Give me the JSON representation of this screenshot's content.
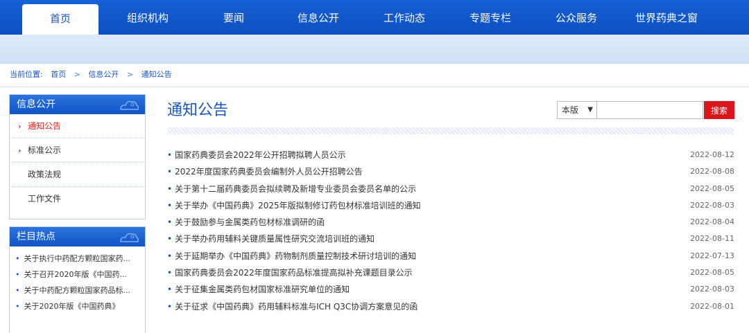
{
  "nav": {
    "items": [
      "首页",
      "组织机构",
      "要闻",
      "信息公开",
      "工作动态",
      "专题专栏",
      "公众服务",
      "世界药典之窗"
    ]
  },
  "breadcrumb": {
    "label": "当前位置:",
    "sep": ">",
    "items": [
      "首页",
      "信息公开",
      "通知公告"
    ]
  },
  "sidebar": {
    "section_title": "信息公开",
    "items": [
      "通知公告",
      "标准公示",
      "政策法规",
      "工作文件"
    ],
    "hot_title": "栏目热点",
    "hot_items": [
      "关于执行中药配方颗粒国家药...",
      "关于召开2020年版《中国药...",
      "关于中药配方颗粒国家药品标...",
      "关于2020年版《中国药典》"
    ]
  },
  "main": {
    "title": "通知公告",
    "search": {
      "scope": "本版",
      "placeholder": "",
      "button": "搜索"
    },
    "news": [
      {
        "title": "国家药典委员会2022年公开招聘拟聘人员公示",
        "date": "2022-08-12"
      },
      {
        "title": "2022年度国家药典委员会编制外人员公开招聘公告",
        "date": "2022-08-08"
      },
      {
        "title": "关于第十二届药典委员会拟续聘及新增专业委员会委员名单的公示",
        "date": "2022-08-05"
      },
      {
        "title": "关于举办《中国药典》2025年版拟制修订药包材标准培训班的通知",
        "date": "2022-08-03"
      },
      {
        "title": "关于鼓励参与金属类药包材标准调研的函",
        "date": "2022-08-04"
      },
      {
        "title": "关于举办药用辅料关键质量属性研究交流培训班的通知",
        "date": "2022-08-11"
      },
      {
        "title": "关于延期举办《中国药典》药物制剂质量控制技术研讨培训的通知",
        "date": "2022-07-13"
      },
      {
        "title": "国家药典委员会2022年度国家药品标准提高拟补充课题目录公示",
        "date": "2022-08-05"
      },
      {
        "title": "关于征集金属类药包材国家标准研究单位的通知",
        "date": "2022-08-03"
      },
      {
        "title": "关于征求《中国药典》药用辅料标准与ICH Q3C协调方案意见的函",
        "date": "2022-08-01"
      }
    ]
  },
  "colors": {
    "nav_blue": "#1561d6",
    "accent_red": "#d9161e",
    "link_blue": "#1a56c6"
  }
}
